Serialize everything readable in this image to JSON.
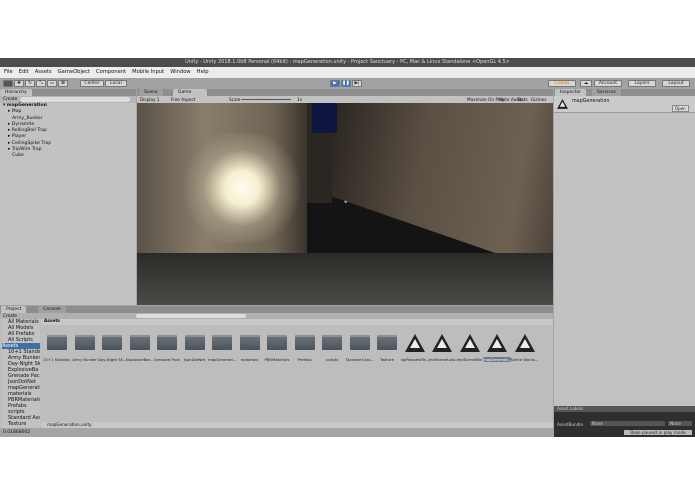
{
  "window_title": "Unity - Unity 2018.1.0b8 Personal (64bit) - mapGeneration.unity - Project Sanctuary - PC, Mac & Linux Standalone <OpenGL 4.5>",
  "menu": [
    "File",
    "Edit",
    "Assets",
    "GameObject",
    "Component",
    "Mobile Input",
    "Window",
    "Help"
  ],
  "toolbar": {
    "center": "Center",
    "local": "Local",
    "collab": "Collab",
    "account": "Account",
    "layers": "Layers",
    "layout": "Layout"
  },
  "hierarchy": {
    "tab": "Hierarchy",
    "create": "Create",
    "scene": "mapGeneration",
    "items": [
      "Map",
      "Army_Bunker",
      "Dynamite",
      "RollingBall Trap",
      "Player",
      "CeilingSpike Trap",
      "TripWire Trap",
      "Cube"
    ]
  },
  "game_view": {
    "tabs": [
      "Scene",
      "Game"
    ],
    "display": "Display 1",
    "aspect": "Free Aspect",
    "scale_label": "Scale",
    "scale_value": "1x",
    "buttons": [
      "Maximize On Play",
      "Mute Audio",
      "Stats",
      "Gizmos"
    ]
  },
  "inspector": {
    "tabs": [
      "Inspector",
      "Services"
    ],
    "object": "mapGeneration",
    "open": "Open",
    "asset_labels": "Asset Labels",
    "assetbundle_label": "AssetBundle",
    "assetbundle_value": "None",
    "variant_value": "None",
    "play_mode_note": "Bake paused in play mode"
  },
  "project": {
    "tabs": [
      "Project",
      "Console"
    ],
    "create": "Create",
    "favorites": [
      "All Materials",
      "All Models",
      "All Prefabs",
      "All Scripts"
    ],
    "root": "Assets",
    "tree": [
      "10+1 Standard",
      "Army Bunker",
      "Day-Night Sk",
      "ExplosiveBa",
      "Grenade Pack",
      "JsonDotNet",
      "mapGeneration",
      "materials",
      "PBRMaterials",
      "Prefabs",
      "scripts",
      "Standard Assets",
      "Texture"
    ],
    "breadcrumb": "Assets",
    "folders": [
      "10+1 Standar...",
      "Army Bunker",
      "Day-Night Sk...",
      "ExplosiveBar...",
      "Grenade Pack",
      "JsonDotNet",
      "mapGenerati...",
      "materials",
      "PBRMaterials",
      "Prefabs",
      "scripts",
      "Standard Ass...",
      "Texture"
    ],
    "scenes": [
      "apiRequestTe...",
      "endSceneLoss",
      "endSceneWin",
      "mapGenerati...",
      "Scene Works..."
    ],
    "footer_file": "mapGeneration.unity"
  },
  "status": "0.01868602"
}
